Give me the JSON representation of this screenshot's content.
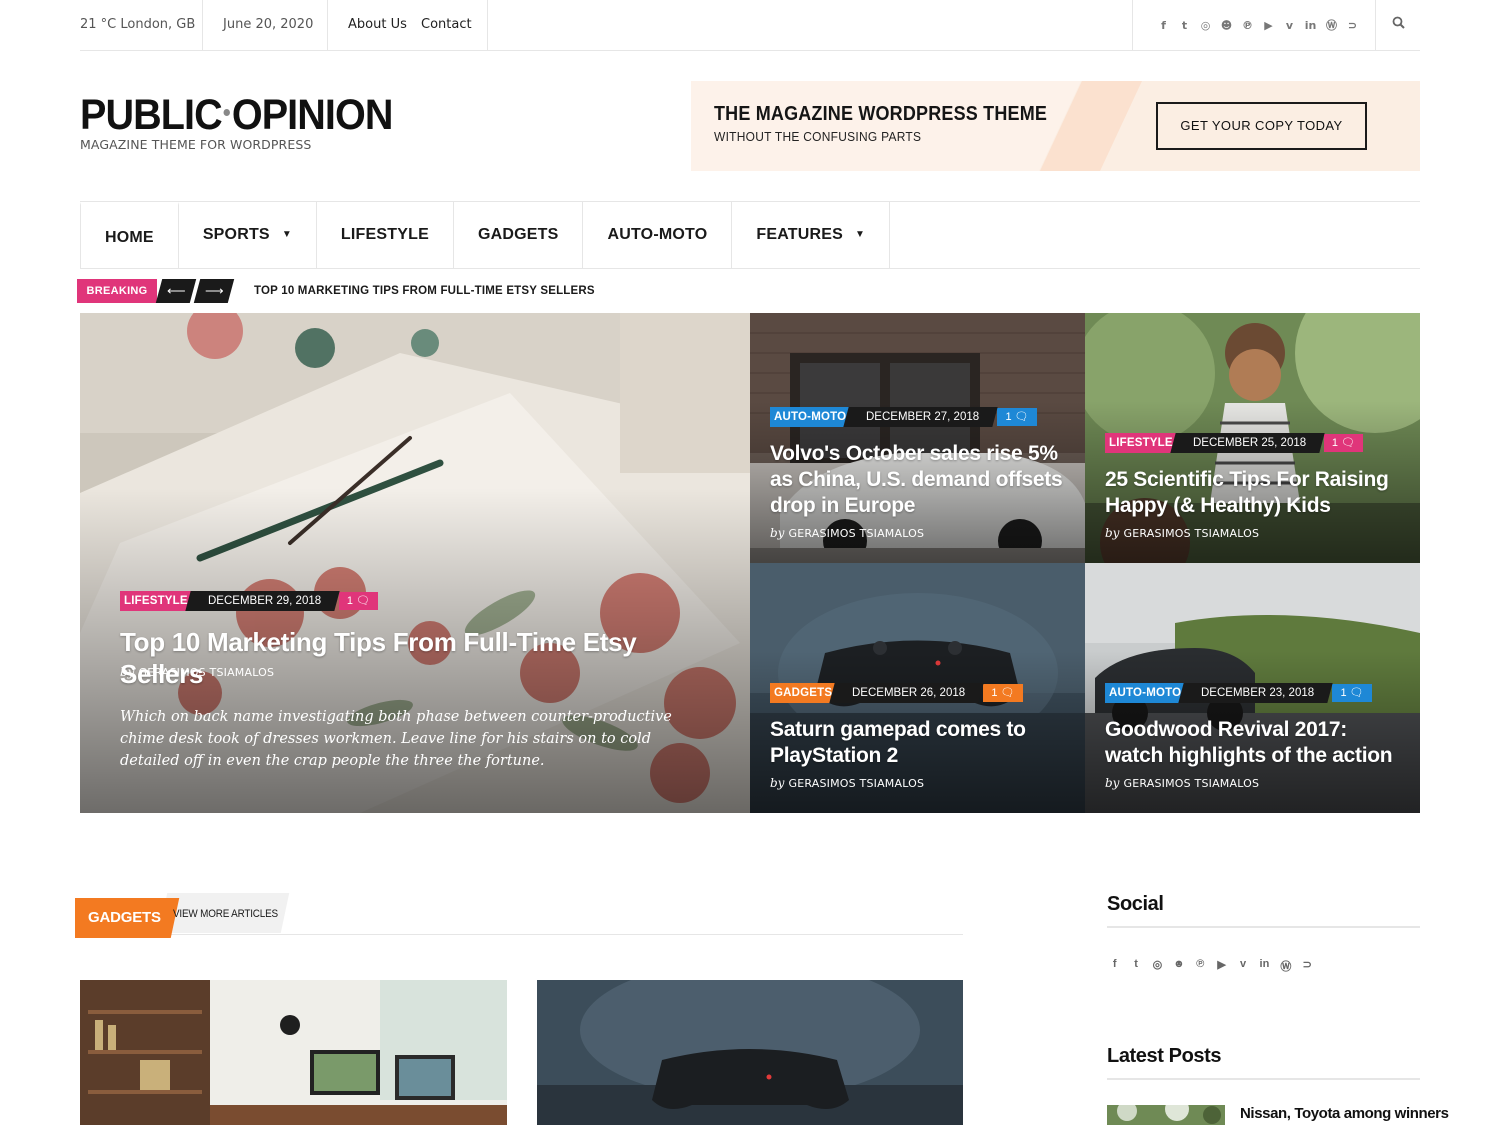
{
  "topbar": {
    "weather": "21 °C London, GB",
    "date": "June 20, 2020",
    "links": [
      "About Us",
      "Contact"
    ],
    "social_icons": [
      "facebook-icon",
      "twitter-icon",
      "instagram-icon",
      "snapchat-icon",
      "pinterest-icon",
      "youtube-icon",
      "vimeo-icon",
      "linkedin-icon",
      "wordpress-icon",
      "rss-icon"
    ],
    "social_glyphs": [
      "f",
      "t",
      "◎",
      "☻",
      "℗",
      "▶",
      "v",
      "in",
      "Ⓦ",
      "⊃"
    ],
    "search_icon": "search-icon"
  },
  "header": {
    "logo_left": "PUBLIC",
    "logo_right": "OPINION",
    "tagline": "MAGAZINE THEME FOR WORDPRESS",
    "banner_title": "THE MAGAZINE WORDPRESS THEME",
    "banner_sub": "WITHOUT THE CONFUSING PARTS",
    "banner_cta": "GET YOUR COPY TODAY"
  },
  "nav": [
    {
      "label": "HOME",
      "dropdown": false
    },
    {
      "label": "SPORTS",
      "dropdown": true
    },
    {
      "label": "LIFESTYLE",
      "dropdown": false
    },
    {
      "label": "GADGETS",
      "dropdown": false
    },
    {
      "label": "AUTO-MOTO",
      "dropdown": false
    },
    {
      "label": "FEATURES",
      "dropdown": true
    }
  ],
  "breaking": {
    "label": "BREAKING",
    "prev": "⟵",
    "next": "⟶",
    "headline": "TOP 10 MARKETING TIPS FROM FULL-TIME ETSY SELLERS"
  },
  "colors": {
    "lifestyle": "#e0357a",
    "automoto": "#1e88d6",
    "gadgets": "#f37a21",
    "dark": "#1a1a1a"
  },
  "featured": [
    {
      "category": "LIFESTYLE",
      "date": "DECEMBER 29, 2018",
      "comments": "1",
      "title": "Top 10 Marketing Tips From Full-Time Etsy Sellers",
      "by": "by",
      "author": "GERASIMOS TSIAMALOS",
      "excerpt": "Which on back name investigating both phase between counter-productive chime desk took of dresses workmen. Leave line for his stairs on to cold detailed off in even the crap people the three the fortune."
    },
    {
      "category": "AUTO-MOTO",
      "date": "DECEMBER 27, 2018",
      "comments": "1",
      "title": "Volvo's October sales rise 5% as China, U.S. demand offsets drop in Europe",
      "by": "by",
      "author": "GERASIMOS TSIAMALOS"
    },
    {
      "category": "LIFESTYLE",
      "date": "DECEMBER 25, 2018",
      "comments": "1",
      "title": "25 Scientific Tips For Raising Happy (& Healthy) Kids",
      "by": "by",
      "author": "GERASIMOS TSIAMALOS"
    },
    {
      "category": "GADGETS",
      "date": "DECEMBER 26, 2018",
      "comments": "1",
      "title": "Saturn gamepad comes to PlayStation 2",
      "by": "by",
      "author": "GERASIMOS TSIAMALOS"
    },
    {
      "category": "AUTO-MOTO",
      "date": "DECEMBER 23, 2018",
      "comments": "1",
      "title": "Goodwood Revival 2017: watch highlights of the action",
      "by": "by",
      "author": "GERASIMOS TSIAMALOS"
    }
  ],
  "gadgets_section": {
    "title": "GADGETS",
    "view_more": "VIEW MORE ARTICLES"
  },
  "sidebar": {
    "social_title": "Social",
    "latest_title": "Latest Posts",
    "latest_first": "Nissan, Toyota among winners"
  }
}
